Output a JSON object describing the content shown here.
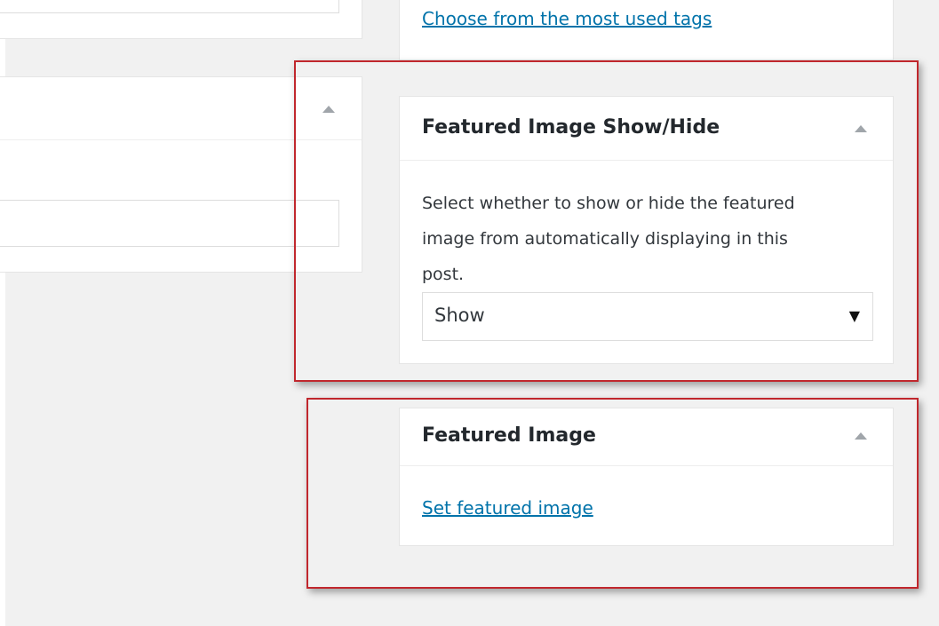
{
  "tags_box": {
    "link_label": "Choose from the most used tags"
  },
  "featured_show_hide": {
    "title": "Featured Image Show/Hide",
    "description": "Select whether to show or hide the featured image from automatically displaying in this post.",
    "select_value": "Show",
    "caret": "▼",
    "toggle_icon": "arrow-up-icon"
  },
  "featured_image": {
    "title": "Featured Image",
    "link_label": "Set featured image",
    "toggle_icon": "arrow-up-icon"
  },
  "highlight_color": "#c0272d",
  "link_color": "#0073aa"
}
